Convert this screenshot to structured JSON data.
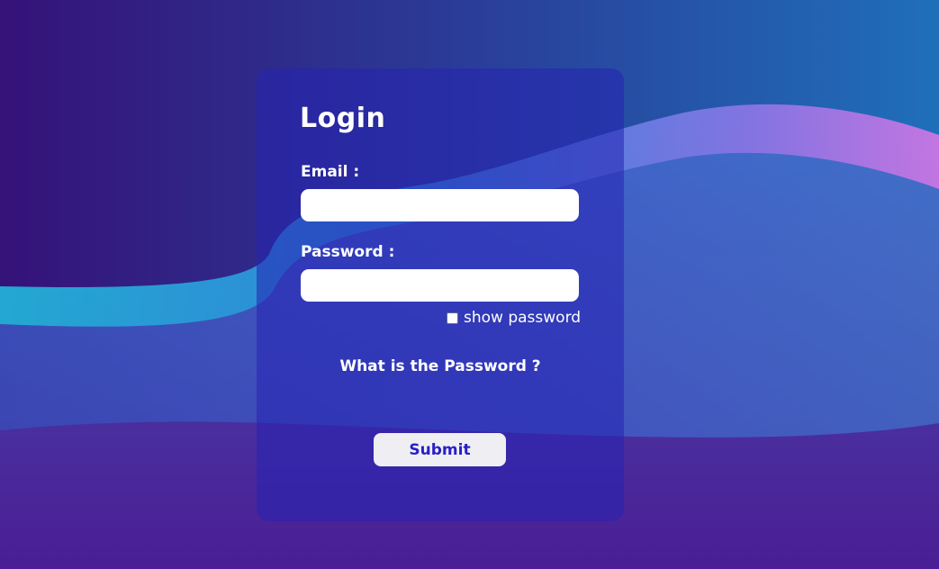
{
  "login": {
    "title": "Login",
    "email_label": "Email :",
    "email_value": "",
    "password_label": "Password :",
    "password_value": "",
    "show_password_label": "show password",
    "show_password_checked": false,
    "help_link": "What is the Password ?",
    "submit_label": "Submit"
  },
  "colors": {
    "card": "#2622b2",
    "submit_text": "#2a1ec8",
    "wave_cyan": "#25b6d8",
    "wave_pink": "#c77be8"
  }
}
